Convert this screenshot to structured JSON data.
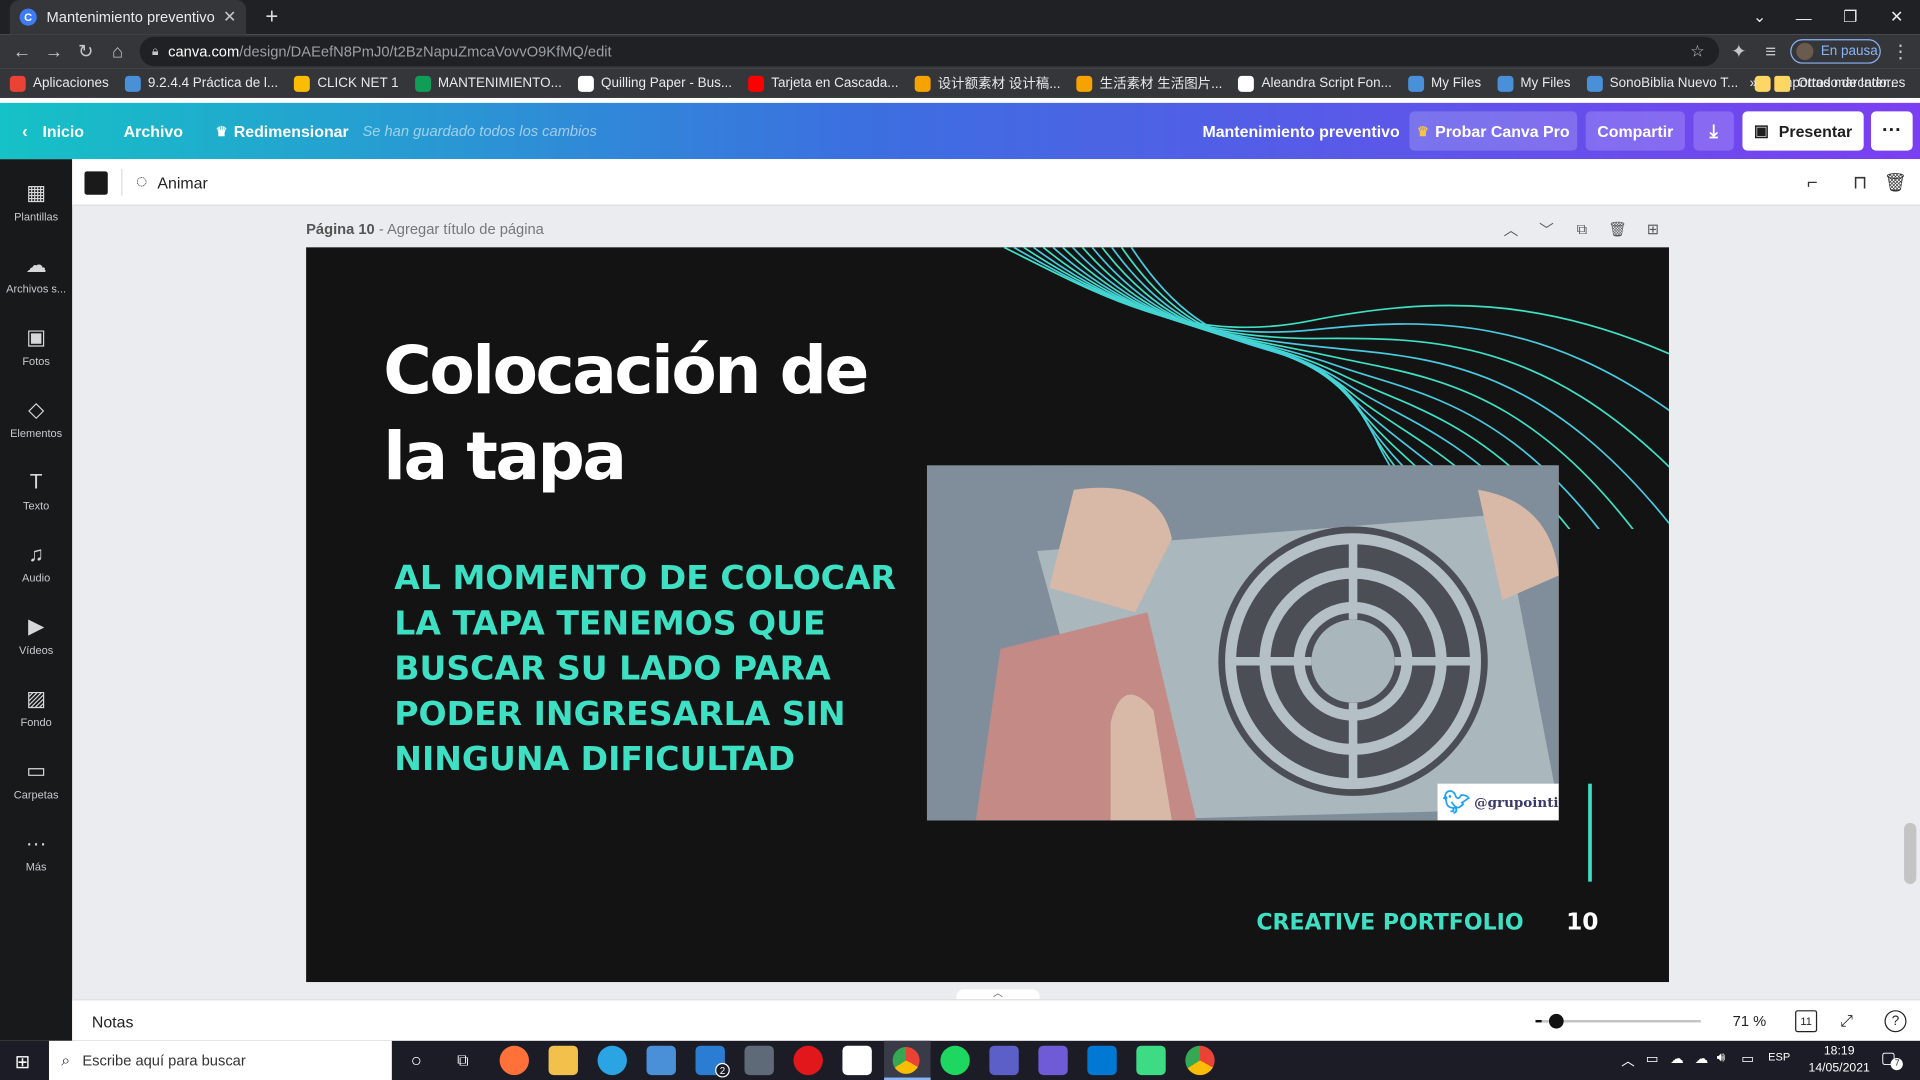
{
  "browser": {
    "tab_title": "Mantenimiento preventivo - Pres",
    "tab_favicon": "C",
    "url_domain": "canva.com",
    "url_path": "/design/DAEefN8PmJ0/t2BzNapuZmcaVovvO9KfMQ/edit",
    "profile_label": "En pausa"
  },
  "bookmarks": [
    {
      "label": "Aplicaciones",
      "color": "#ea4335"
    },
    {
      "label": "9.2.4.4 Práctica de l...",
      "color": "#4a90d9"
    },
    {
      "label": "CLICK NET 1",
      "color": "#fbbc04"
    },
    {
      "label": "MANTENIMIENTO...",
      "color": "#0f9d58"
    },
    {
      "label": "Quilling Paper - Bus...",
      "color": "#ffffff"
    },
    {
      "label": "Tarjeta en Cascada...",
      "color": "#ff0000"
    },
    {
      "label": "设计额素材 设计稿...",
      "color": "#f6a200"
    },
    {
      "label": "生活素材 生活图片...",
      "color": "#f6a200"
    },
    {
      "label": "Aleandra Script Fon...",
      "color": "#ffffff"
    },
    {
      "label": "My Files",
      "color": "#4a90d9"
    },
    {
      "label": "My Files",
      "color": "#4a90d9"
    },
    {
      "label": "SonoBiblia Nuevo T...",
      "color": "#4a90d9"
    },
    {
      "label": "Importado de Inter...",
      "color": "#fdd663"
    }
  ],
  "bookmarks_other": "Otros marcadores",
  "canva": {
    "home_label": "Inicio",
    "file_label": "Archivo",
    "resize_label": "Redimensionar",
    "saved_status": "Se han guardado todos los cambios",
    "doc_title": "Mantenimiento preventivo",
    "pro_label": "Probar Canva Pro",
    "share_label": "Compartir",
    "present_label": "Presentar"
  },
  "sidebar": [
    {
      "label": "Plantillas",
      "icon": "templates-icon",
      "glyph": "▦"
    },
    {
      "label": "Archivos s...",
      "icon": "upload-icon",
      "glyph": "☁"
    },
    {
      "label": "Fotos",
      "icon": "photos-icon",
      "glyph": "▣"
    },
    {
      "label": "Elementos",
      "icon": "elements-icon",
      "glyph": "◇"
    },
    {
      "label": "Texto",
      "icon": "text-icon",
      "glyph": "T"
    },
    {
      "label": "Audio",
      "icon": "audio-icon",
      "glyph": "♫"
    },
    {
      "label": "Vídeos",
      "icon": "video-icon",
      "glyph": "▶"
    },
    {
      "label": "Fondo",
      "icon": "background-icon",
      "glyph": "▨"
    },
    {
      "label": "Carpetas",
      "icon": "folder-icon",
      "glyph": "▭"
    },
    {
      "label": "Más",
      "icon": "more-icon",
      "glyph": "···"
    }
  ],
  "toolbar": {
    "animate_label": "Animar",
    "text_color": "#1a1a1a"
  },
  "page": {
    "label": "Página 10",
    "title_placeholder": " - Agregar título de página"
  },
  "slide": {
    "title": "Colocación de la tapa",
    "body": "AL MOMENTO DE COLOCAR LA TAPA TENEMOS QUE BUSCAR SU LADO PARA PODER INGRESARLA SIN NINGUNA DIFICULTAD",
    "watermark_handle": "@grupointi",
    "footer_label": "CREATIVE PORTFOLIO",
    "page_number": "10",
    "accent_color": "#3ee0c4",
    "background_color": "#131313"
  },
  "bottombar": {
    "notes_label": "Notas",
    "zoom": "71 %",
    "zoom_fraction": 0.12,
    "page_count": "11"
  },
  "taskbar": {
    "search_placeholder": "Escribe aquí para buscar",
    "mail_badge": "2",
    "language": "ESP",
    "time": "18:19",
    "date": "14/05/2021",
    "notifications": "7"
  }
}
